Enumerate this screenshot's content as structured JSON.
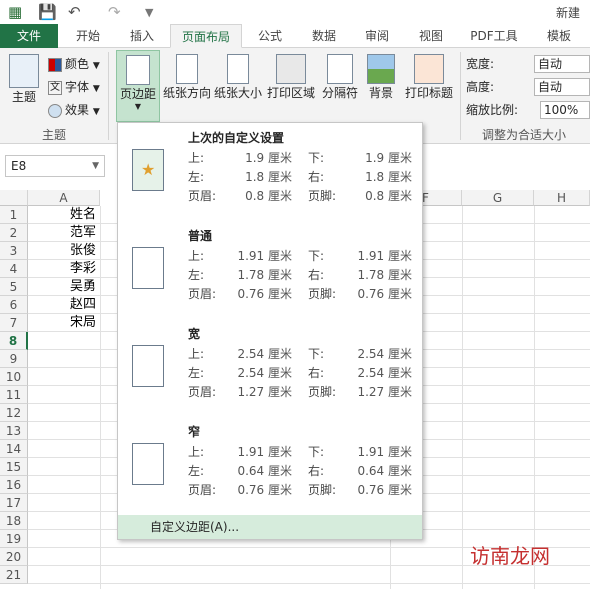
{
  "qat": {
    "title": "新建"
  },
  "tabs": [
    {
      "label": "文件"
    },
    {
      "label": "开始"
    },
    {
      "label": "插入"
    },
    {
      "label": "页面布局"
    },
    {
      "label": "公式"
    },
    {
      "label": "数据"
    },
    {
      "label": "审阅"
    },
    {
      "label": "视图"
    },
    {
      "label": "PDF工具"
    },
    {
      "label": "模板"
    }
  ],
  "ribbon": {
    "theme": {
      "label": "主题",
      "colors": "颜色",
      "fonts": "字体",
      "effects": "效果",
      "group": "主题"
    },
    "margins": "页边距",
    "orientation": "纸张方向",
    "size": "纸张大小",
    "print_area": "打印区域",
    "breaks": "分隔符",
    "background": "背景",
    "print_titles": "打印标题",
    "scale": {
      "width_label": "宽度:",
      "width_value": "自动",
      "height_label": "高度:",
      "height_value": "自动",
      "zoom_label": "缩放比例:",
      "zoom_value": "100%",
      "group": "调整为合适大小"
    }
  },
  "namebox": "E8",
  "columns": [
    "A",
    "F",
    "G",
    "H"
  ],
  "rows": [
    "1",
    "2",
    "3",
    "4",
    "5",
    "6",
    "7",
    "8",
    "9",
    "10",
    "11",
    "12",
    "13",
    "14",
    "15",
    "16",
    "17",
    "18",
    "19",
    "20",
    "21"
  ],
  "cells": [
    "姓名",
    "范军",
    "张俊",
    "李彩",
    "吴勇",
    "赵四",
    "宋局"
  ],
  "dropdown": {
    "options": [
      {
        "title": "上次的自定义设置",
        "top_l": "上:",
        "top_v": "1.9 厘米",
        "bottom_l": "下:",
        "bottom_v": "1.9 厘米",
        "left_l": "左:",
        "left_v": "1.8 厘米",
        "right_l": "右:",
        "right_v": "1.8 厘米",
        "header_l": "页眉:",
        "header_v": "0.8 厘米",
        "footer_l": "页脚:",
        "footer_v": "0.8 厘米"
      },
      {
        "title": "普通",
        "top_l": "上:",
        "top_v": "1.91 厘米",
        "bottom_l": "下:",
        "bottom_v": "1.91 厘米",
        "left_l": "左:",
        "left_v": "1.78 厘米",
        "right_l": "右:",
        "right_v": "1.78 厘米",
        "header_l": "页眉:",
        "header_v": "0.76 厘米",
        "footer_l": "页脚:",
        "footer_v": "0.76 厘米"
      },
      {
        "title": "宽",
        "top_l": "上:",
        "top_v": "2.54 厘米",
        "bottom_l": "下:",
        "bottom_v": "2.54 厘米",
        "left_l": "左:",
        "left_v": "2.54 厘米",
        "right_l": "右:",
        "right_v": "2.54 厘米",
        "header_l": "页眉:",
        "header_v": "1.27 厘米",
        "footer_l": "页脚:",
        "footer_v": "1.27 厘米"
      },
      {
        "title": "窄",
        "top_l": "上:",
        "top_v": "1.91 厘米",
        "bottom_l": "下:",
        "bottom_v": "1.91 厘米",
        "left_l": "左:",
        "left_v": "0.64 厘米",
        "right_l": "右:",
        "right_v": "0.64 厘米",
        "header_l": "页眉:",
        "header_v": "0.76 厘米",
        "footer_l": "页脚:",
        "footer_v": "0.76 厘米"
      }
    ],
    "custom": "自定义边距(A)..."
  },
  "watermark": "访南龙网"
}
